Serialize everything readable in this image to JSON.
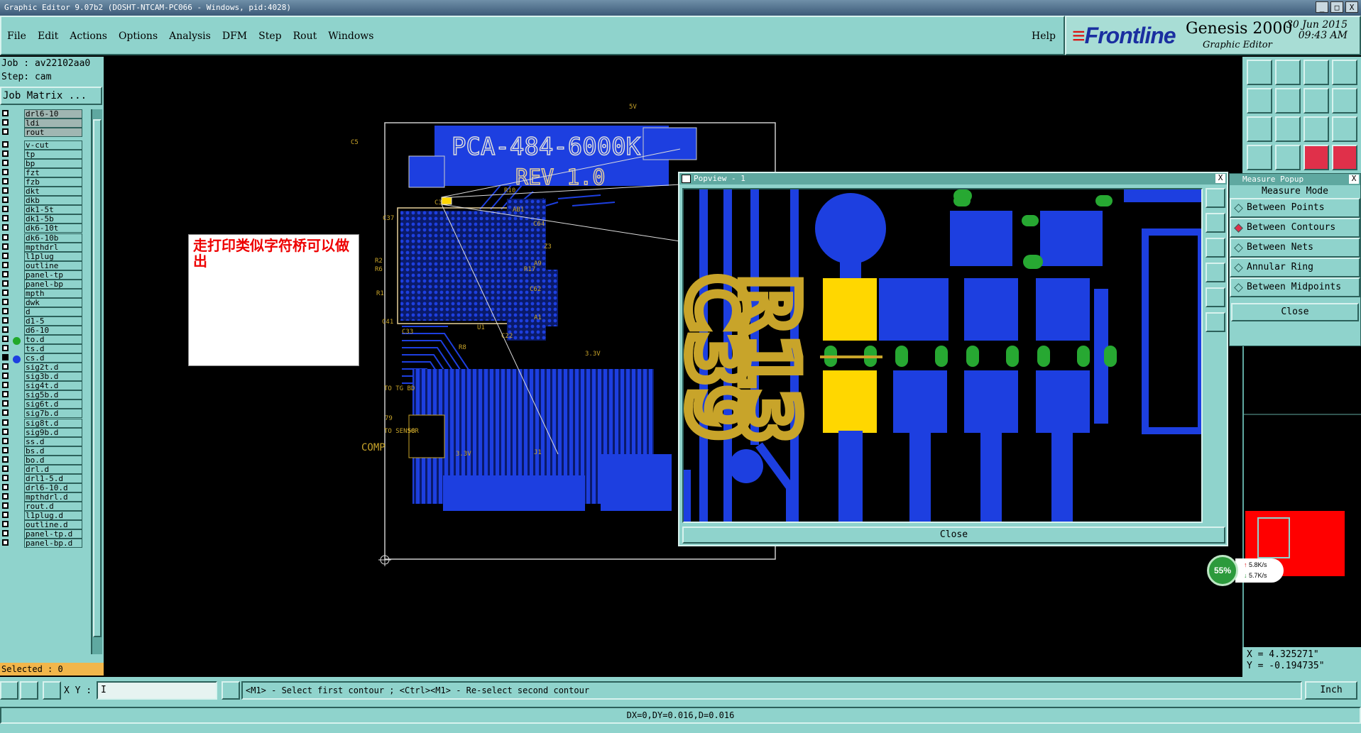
{
  "window": {
    "title": "Graphic Editor 9.07b2 (DOSHT-NTCAM-PC066 - Windows, pid:4028)",
    "controls": [
      "_",
      "□",
      "X"
    ]
  },
  "menu": {
    "items": [
      "File",
      "Edit",
      "Actions",
      "Options",
      "Analysis",
      "DFM",
      "Step",
      "Rout",
      "Windows"
    ],
    "help": "Help"
  },
  "brand": {
    "logo": "Frontline",
    "product": "Genesis 2000",
    "subtitle": "Graphic Editor",
    "date": "30 Jun 2015",
    "time": "09:43 AM"
  },
  "job": {
    "job_line": "Job : av22102aa0",
    "step_line": "Step: cam",
    "matrix_button": "Job Matrix ..."
  },
  "layers": [
    {
      "name": "drl6-10",
      "gray": true
    },
    {
      "name": "ldi",
      "gray": true
    },
    {
      "name": "rout",
      "gray": true
    },
    {
      "name": "v-cut"
    },
    {
      "name": "tp"
    },
    {
      "name": "bp"
    },
    {
      "name": "fzt"
    },
    {
      "name": "fzb"
    },
    {
      "name": "dkt"
    },
    {
      "name": "dkb"
    },
    {
      "name": "dk1-5t"
    },
    {
      "name": "dk1-5b"
    },
    {
      "name": "dk6-10t"
    },
    {
      "name": "dk6-10b"
    },
    {
      "name": "mpthdrl"
    },
    {
      "name": "l1plug"
    },
    {
      "name": "outline"
    },
    {
      "name": "panel-tp"
    },
    {
      "name": "panel-bp"
    },
    {
      "name": "mpth"
    },
    {
      "name": "dwk"
    },
    {
      "name": "d"
    },
    {
      "name": "d1-5"
    },
    {
      "name": "d6-10"
    },
    {
      "name": "to.d",
      "dot": "#21a82a"
    },
    {
      "name": "ts.d"
    },
    {
      "name": "cs.d",
      "dot": "#1d3fe0",
      "filled": true
    },
    {
      "name": "sig2t.d"
    },
    {
      "name": "sig3b.d"
    },
    {
      "name": "sig4t.d"
    },
    {
      "name": "sig5b.d"
    },
    {
      "name": "sig6t.d"
    },
    {
      "name": "sig7b.d"
    },
    {
      "name": "sig8t.d"
    },
    {
      "name": "sig9b.d"
    },
    {
      "name": "ss.d"
    },
    {
      "name": "bs.d"
    },
    {
      "name": "bo.d"
    },
    {
      "name": "drl.d"
    },
    {
      "name": "drl1-5.d"
    },
    {
      "name": "drl6-10.d"
    },
    {
      "name": "mpthdrl.d"
    },
    {
      "name": "rout.d"
    },
    {
      "name": "l1plug.d"
    },
    {
      "name": "outline.d"
    },
    {
      "name": "panel-tp.d"
    },
    {
      "name": "panel-bp.d"
    }
  ],
  "selected": "Selected : 0",
  "annotation": "走打印类似字符桥可以做出",
  "board": {
    "part": "PCA-484-6000K",
    "rev": "REV 1.0",
    "labels": [
      "TO TG BD",
      "TO SENSOR",
      "COMP",
      "5V",
      "3.3V",
      "A1",
      "A9",
      "U1",
      "C33",
      "R1",
      "R2",
      "R6",
      "C41",
      "AB1",
      "R10",
      "R17",
      "C62",
      "C64",
      "C37",
      "C38",
      "R8",
      "C5",
      "79",
      "58",
      "J1",
      "3.3V",
      "C22",
      "Z3"
    ]
  },
  "popview": {
    "title": "Popview - 1",
    "close": "Close",
    "text_marks": [
      "C39",
      "R13"
    ]
  },
  "measure": {
    "title": "Measure Popup",
    "heading": "Measure Mode",
    "options": [
      {
        "label": "Between Points",
        "selected": false
      },
      {
        "label": "Between Contours",
        "selected": true
      },
      {
        "label": "Between Nets",
        "selected": false
      },
      {
        "label": "Annular Ring",
        "selected": false
      },
      {
        "label": "Between Midpoints",
        "selected": false
      }
    ],
    "close": "Close"
  },
  "coords": {
    "x": "X = 4.325271\"",
    "y": "Y = -0.194735\""
  },
  "netspeed": {
    "percent": "55%",
    "up": "5.8K/s",
    "down": "5.7K/s"
  },
  "bottom": {
    "xy_label": "X Y :",
    "xy_value": "I",
    "prompt": "<M1> - Select first contour ; <Ctrl><M1> - Re-select second contour",
    "unit": "Inch",
    "status": "DX=0,DY=0.016,D=0.016"
  },
  "colors": {
    "panel": "#8fd3cc",
    "copper": "#1d3fe0",
    "pad": "#ffd700",
    "silk": "#c8a42a",
    "accent": "#e0304a",
    "selected_bg": "#f2b64b"
  }
}
